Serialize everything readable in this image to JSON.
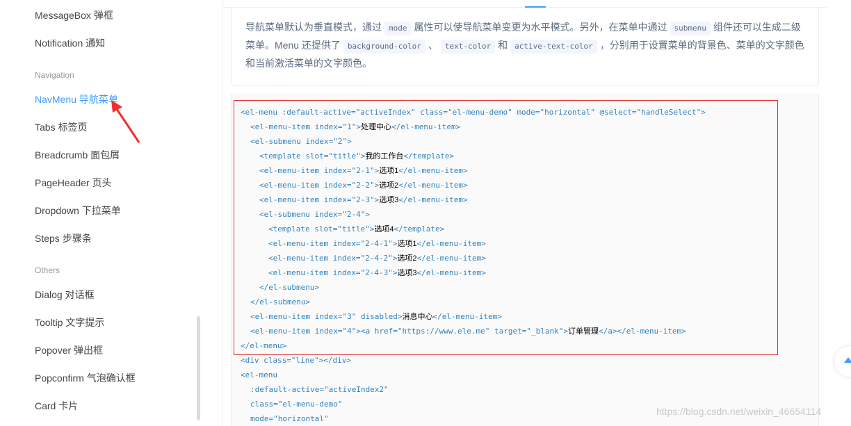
{
  "sidebar": {
    "items": [
      {
        "label": "MessageBox 弹框"
      },
      {
        "label": "Notification 通知"
      },
      {
        "label": "NavMenu 导航菜单"
      },
      {
        "label": "Tabs 标签页"
      },
      {
        "label": "Breadcrumb 面包屑"
      },
      {
        "label": "PageHeader 页头"
      },
      {
        "label": "Dropdown 下拉菜单"
      },
      {
        "label": "Steps 步骤条"
      },
      {
        "label": "Dialog 对话框"
      },
      {
        "label": "Tooltip 文字提示"
      },
      {
        "label": "Popover 弹出框"
      },
      {
        "label": "Popconfirm 气泡确认框"
      },
      {
        "label": "Card 卡片"
      }
    ],
    "groups": {
      "navigation": "Navigation",
      "others": "Others"
    },
    "active_color": "#409eff"
  },
  "description": {
    "t1": "导航菜单默认为垂直模式，通过",
    "c1": "mode",
    "t2": "属性可以使导航菜单变更为水平模式。另外，在菜单中通过",
    "c2": "submenu",
    "t3": "组件还可以生成二级菜单。Menu 还提供了",
    "c3": "background-color",
    "t4": "、",
    "c4": "text-color",
    "t5": "和",
    "c5": "active-text-color",
    "t6": "，分别用于设置菜单的背景色、菜单的文字颜色和当前激活菜单的文字颜色。"
  },
  "code": {
    "l1": "<el-menu :default-active=\"activeIndex\" class=\"el-menu-demo\" mode=\"horizontal\" @select=\"handleSelect\">",
    "l2a": "<el-menu-item index=\"1\">",
    "l2b": "处理中心",
    "l2c": "</el-menu-item>",
    "l3": "<el-submenu index=\"2\">",
    "l4a": "<template slot=\"title\">",
    "l4b": "我的工作台",
    "l4c": "</template>",
    "l5a": "<el-menu-item index=\"2-1\">",
    "l5b": "选项1",
    "l5c": "</el-menu-item>",
    "l6a": "<el-menu-item index=\"2-2\">",
    "l6b": "选项2",
    "l6c": "</el-menu-item>",
    "l7a": "<el-menu-item index=\"2-3\">",
    "l7b": "选项3",
    "l7c": "</el-menu-item>",
    "l8": "<el-submenu index=\"2-4\">",
    "l9a": "<template slot=\"title\">",
    "l9b": "选项4",
    "l9c": "</template>",
    "l10a": "<el-menu-item index=\"2-4-1\">",
    "l10b": "选项1",
    "l10c": "</el-menu-item>",
    "l11a": "<el-menu-item index=\"2-4-2\">",
    "l11b": "选项2",
    "l11c": "</el-menu-item>",
    "l12a": "<el-menu-item index=\"2-4-3\">",
    "l12b": "选项3",
    "l12c": "</el-menu-item>",
    "l13": "</el-submenu>",
    "l14": "</el-submenu>",
    "l15a": "<el-menu-item index=\"3\" disabled>",
    "l15b": "消息中心",
    "l15c": "</el-menu-item>",
    "l16a": "<el-menu-item index=\"4\"><a href=\"https://www.ele.me\" target=\"_blank\">",
    "l16b": "订单管理",
    "l16c": "</a></el-menu-item>",
    "l17": "</el-menu>",
    "l18": "<div class=\"line\"></div>",
    "l19": "<el-menu",
    "l20": ":default-active=\"activeIndex2\"",
    "l21": "class=\"el-menu-demo\"",
    "l22": "mode=\"horizontal\""
  },
  "watermark": "https://blog.csdn.net/weixin_46654114",
  "icons": {
    "arrow": "red-arrow-icon",
    "back_top": "caret-up-icon"
  },
  "colors": {
    "code_tag": "#3182bd",
    "highlight_border": "#e03030"
  }
}
